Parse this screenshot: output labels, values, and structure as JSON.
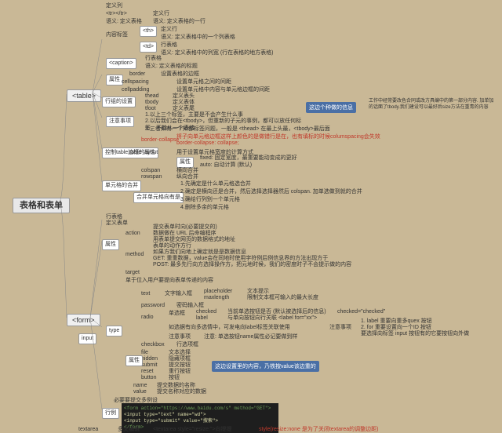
{
  "root": "表格和表单",
  "table": {
    "label": "<table>",
    "sections": {
      "defcol": {
        "title": "定义列",
        "sub": {
          "trtxt": "<tr></tr>",
          "trmean": "语义: 定义表格",
          "sub2": {
            "defrow": "定义行",
            "thmean": "语义: 定义表格的一行",
            "th": "<th>",
            "thtxt": "定义行",
            "thdesc": "语义: 定义表格中的一个列表格",
            "td": "<td>",
            "tdtxt": "行表格",
            "tddesc": "语义: 定义表格中的列宽 (行在表格的地方表格)"
          }
        }
      },
      "caption": {
        "label": "<caption>",
        "txt": "行表格",
        "desc": "语义: 定义表格的标题"
      },
      "attrs": {
        "title": "属性",
        "items": {
          "border": "border",
          "borderdesc": "设置表格的边框",
          "cellspacing": "cellspacing",
          "cellspacingdesc": "设置单元格之间的间距",
          "cellpadding": "cellpadding",
          "cellpaddingdesc": "设置单元格中内容与单元格边框的间距"
        }
      },
      "struct": {
        "title": "行组的设置",
        "items": {
          "thead": "thead",
          "theaddesc": "定义表头",
          "tbody": "tbody",
          "tbodydesc": "定义表体",
          "tfoot": "tfoot",
          "tfootdesc": "定义表尾"
        }
      },
      "note": {
        "title": "注意事项",
        "n1": "1.以上三个标签，主要是不会产生什么事",
        "n2": "2.以后我们会在<tbody>，但重新的子元的事例，都可以放任何标签，不能从一个表格",
        "n3": "3.三者如有一个知都标签问题，一般是 <thead> 在最上头最，<tbody>最后面"
      },
      "notered": "将子向单元格边框这样上颜色的是做错行是在，也有填标的时候columspacing会失效",
      "notecode": "border-collapse: collapse;",
      "border": {
        "title": "控制table边框的属性",
        "items": {
          "tl": "table-layout",
          "tldesc": "用于设置单元格宽度的计算方式",
          "tlsub": "属性",
          "tlfixed": "fixed: 固定宽度，最重要能动变成的更好",
          "tlauto": "auto: 自动计算 (默认)",
          "col": "colspan",
          "coldesc": "横向合并",
          "row": "rowspan",
          "rowdesc": "纵向合并"
        }
      },
      "merge": {
        "title": "单元格的合并",
        "sub": "合并单元格向有是",
        "m1": "1.先确定是什么单元格选合并",
        "m2": "2.确定是横向还是合并，然后选择选择器然后 colspan. 加单选做到就的合并",
        "m3": "3.确给行列别一个单元格",
        "m4": "4.删除多余的单元格"
      }
    }
  },
  "form": {
    "label": "<form>",
    "sections": {
      "basic": {
        "title": "行表格",
        "sub": "定义表单"
      },
      "attrs": {
        "title": "属性",
        "items": {
          "action": "action",
          "actiondesc1": "提交表单时向(必要提交的)",
          "actiondesc2": "数据做在 URL 后命编程序",
          "actiondesc3": "用表单提交网页的数据格式的地址",
          "actiondesc4": "表单的动作方行",
          "method": "method",
          "methoddesc1": "如果方我们向地上确定就是是数据信息",
          "methoddesc2": "GET: 重重数据，value会在同地时使用字符例后例信息界的方法出现方于",
          "methoddesc3": "POST: 最多先行向方选择操作方，把元地时候，我们的密度时子不会提示做的内容",
          "target": "target",
          "targetdesc": "单于位入用户要提向表单传递的内容"
        }
      },
      "input": {
        "label": "input",
        "title": "type",
        "types": {
          "text": {
            "label": "text",
            "desc": "文字输入框",
            "sub": {
              "ph": "placeholder",
              "phdesc": "文本提示",
              "ml": "maxlength",
              "mldesc": "限制文本框可输入的最大长度"
            }
          },
          "pwd": {
            "label": "password",
            "desc": "密码输入框"
          },
          "radio": {
            "label": "radio",
            "desc": "单选框",
            "sub": {
              "ck": "checked",
              "ckdesc": "当前单选按钮是否 (默认被选择后的信息)",
              "ckval": "checked=\"checked\"",
              "lb": "label",
              "lbdesc": "与单向按钮向行关联 <label for=\"xx\">"
            },
            "notes": {
              "n1": "1. label 重要向重多quex 按钮",
              "n2": "2. for 重要设置向一个ID 按钮",
              "n3": "要选择向标签 input 按钮有的它要按钮向外做"
            }
          },
          "cb": {
            "label": "checkbox",
            "desc": "行选项框",
            "cbdesc": "如选据有向多选情中，可发电向label标签关联使用",
            "cbnote": "注意事项"
          },
          "file": {
            "label": "file",
            "desc": "文本选择"
          },
          "hidden": {
            "label": "hidden",
            "desc": "隐藏项框"
          },
          "submit": {
            "label": "submit",
            "desc": "提交按钮"
          },
          "reset": {
            "label": "reset",
            "desc": "重行按钮"
          },
          "button": {
            "label": "button",
            "desc": "按钮"
          }
        },
        "typenote": "注意: 单选按钮name属性必记要做到样",
        "misc": {
          "name": "name",
          "namedesc": "提交数据的名称",
          "value": "value",
          "valuedesc": "提交名称对应的数据"
        }
      },
      "callout2": "这边设置里的内容，乃铁按value该边重的",
      "req": "必要要提交多例设",
      "code": {
        "l1": "<form action=\"https://www.baidu.com/s\" method=\"GET\">",
        "l2": "  <input type=\"text\" name=\"wd\">",
        "l3": "  <input type=\"submit\" value=\"搜索\">",
        "l4": "</form>"
      },
      "ta": {
        "label": "textarea",
        "desc": "多文编辑",
        "style": "<textarea style=\"resize:\">向提提",
        "note": "style(resize:none 是为了关闭textarea的调整边距)"
      }
    }
  },
  "sidecallout": "这边个种做的信息",
  "sidetext": "工作中经常要改色合同或改方具编中的第一部分内容. 加单加的话面了tbody.我们建设可以最好后size方法在重青的内容"
}
